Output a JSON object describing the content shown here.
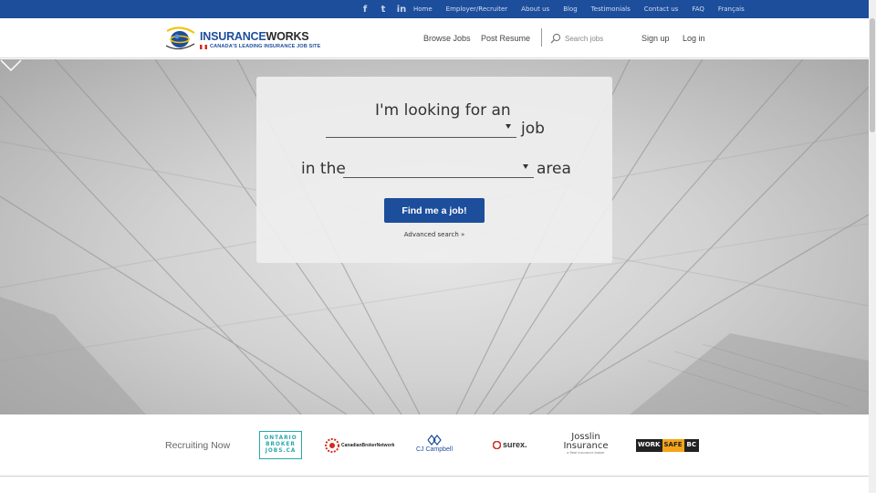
{
  "topbar": {
    "social": [
      {
        "name": "facebook-icon",
        "glyph": "f"
      },
      {
        "name": "twitter-icon",
        "glyph": "t"
      },
      {
        "name": "linkedin-icon",
        "glyph": "in"
      }
    ],
    "links": [
      "Home",
      "Employer/Recruiter",
      "About us",
      "Blog",
      "Testimonials",
      "Contact us",
      "FAQ",
      "Français"
    ]
  },
  "header": {
    "logo": {
      "part1": "INSURANCE",
      "part2": "WORKS",
      "tagline": "CANADA'S LEADING INSURANCE JOB SITE"
    },
    "nav": {
      "browse": "Browse Jobs",
      "post": "Post Resume",
      "signup": "Sign up",
      "login": "Log in"
    },
    "search_placeholder": "Search jobs"
  },
  "hero": {
    "line1": "I'm looking for an",
    "job_word": "job",
    "in_the": "in the",
    "area_word": "area",
    "job_select_value": "",
    "area_select_value": "",
    "button": "Find me a job!",
    "advanced": "Advanced search »"
  },
  "recruiting": {
    "label": "Recruiting Now",
    "partners": {
      "ontario": [
        "ONTARIO",
        "BROKER",
        "JOBS.CA"
      ],
      "cbn": "CanadianBrokerNetwork",
      "cjc": "CJ Campbell",
      "surex": "surex.",
      "josslin": [
        "Josslin",
        "Insurance",
        "a Real Insurance broker"
      ],
      "worksafe": [
        "WORK",
        "SAFE",
        "BC"
      ]
    }
  },
  "colors": {
    "brand_blue": "#1d4e9c",
    "teal": "#2aa7a7",
    "red": "#d52b1e"
  }
}
